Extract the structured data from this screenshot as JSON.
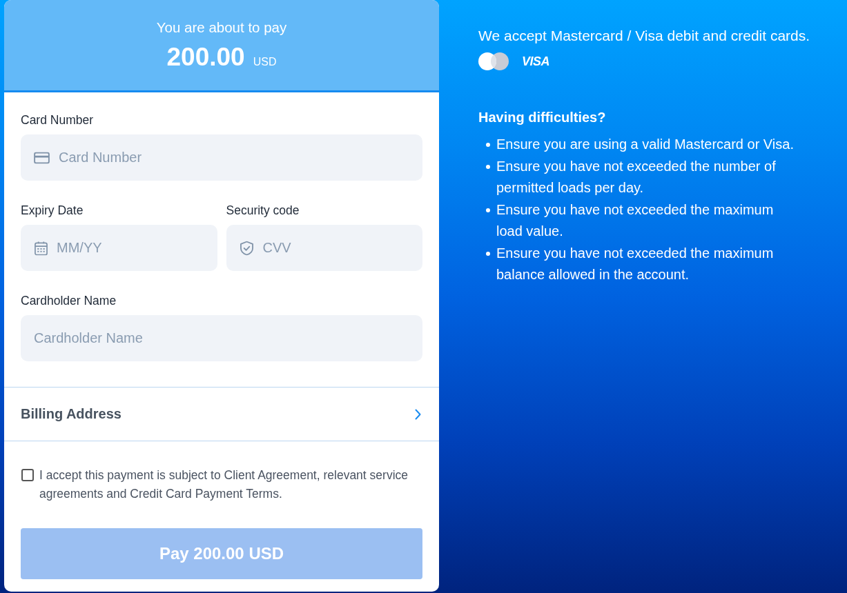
{
  "summary": {
    "title": "You are about to pay",
    "amount": "200.00",
    "currency": "USD"
  },
  "form": {
    "rows": [
      [
        {
          "kind": "card",
          "label": "Card Number",
          "placeholder": "Card Number"
        }
      ],
      [
        {
          "kind": "expiry",
          "label": "Expiry Date",
          "placeholder": "MM/YY"
        },
        {
          "kind": "cvv",
          "label": "Security code",
          "placeholder": "CVV"
        }
      ],
      [
        {
          "kind": "name",
          "label": "Cardholder Name",
          "placeholder": "Cardholder Name"
        }
      ]
    ]
  },
  "billing": {
    "label": "Billing Address",
    "expanded": false
  },
  "agreement": {
    "checked": false,
    "text": "I accept this payment is subject to Client Agreement, relevant service agreements and Credit Card Payment Terms."
  },
  "pay_button": {
    "label": "Pay 200.00 USD",
    "disabled": true
  },
  "accepted": {
    "text": "We accept Mastercard / Visa debit and credit cards.",
    "brands": [
      {
        "kind": "circles"
      },
      {
        "kind": "wordmark",
        "text": "VISA"
      }
    ]
  },
  "help": {
    "title": "Having difficulties?",
    "items": [
      "Ensure you are using a valid Mastercard or Visa.",
      "Ensure you have not exceeded the number of permitted loads per day.",
      "Ensure you have not exceeded the maximum load value.",
      "Ensure you have not exceeded the maximum balance allowed in the account."
    ]
  }
}
